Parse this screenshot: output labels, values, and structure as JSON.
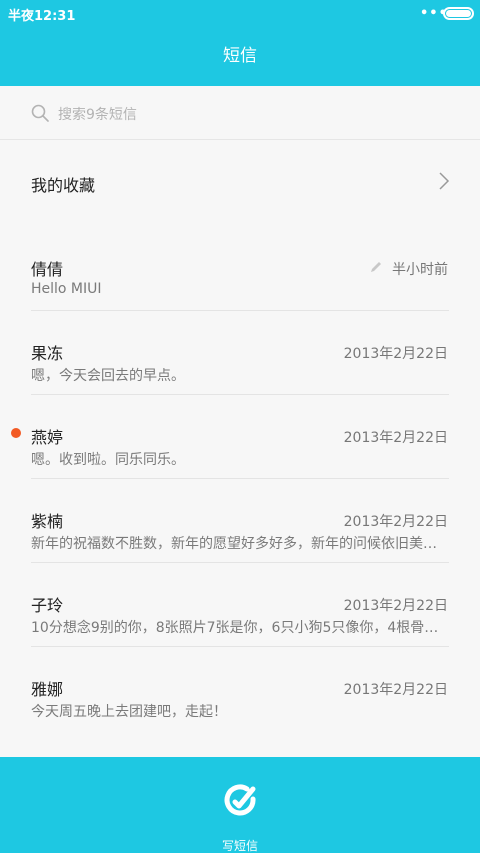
{
  "status_bar": {
    "time": "半夜12:31",
    "dots": "•••"
  },
  "title": "短信",
  "search": {
    "placeholder": "搜索9条短信"
  },
  "favorites": {
    "label": "我的收藏"
  },
  "messages": [
    {
      "name": "倩倩",
      "preview": "Hello MIUI",
      "date": "半小时前",
      "draft": true,
      "unread": false
    },
    {
      "name": "果冻",
      "preview": "嗯，今天会回去的早点。",
      "date": "2013年2月22日",
      "draft": false,
      "unread": false
    },
    {
      "name": "燕婷",
      "preview": "嗯。收到啦。同乐同乐。",
      "date": "2013年2月22日",
      "draft": false,
      "unread": true
    },
    {
      "name": "紫楠",
      "preview": "新年的祝福数不胜数，新年的愿望好多好多，新年的问候依旧美…",
      "date": "2013年2月22日",
      "draft": false,
      "unread": false
    },
    {
      "name": "子玲",
      "preview": "10分想念9别的你，8张照片7张是你，6只小狗5只像你，4根骨…",
      "date": "2013年2月22日",
      "draft": false,
      "unread": false
    },
    {
      "name": "雅娜",
      "preview": "今天周五晚上去团建吧，走起！",
      "date": "2013年2月22日",
      "draft": false,
      "unread": false
    }
  ],
  "bottom": {
    "compose_label": "写短信"
  },
  "colors": {
    "accent": "#1ec8e2",
    "unread": "#f25a24"
  }
}
